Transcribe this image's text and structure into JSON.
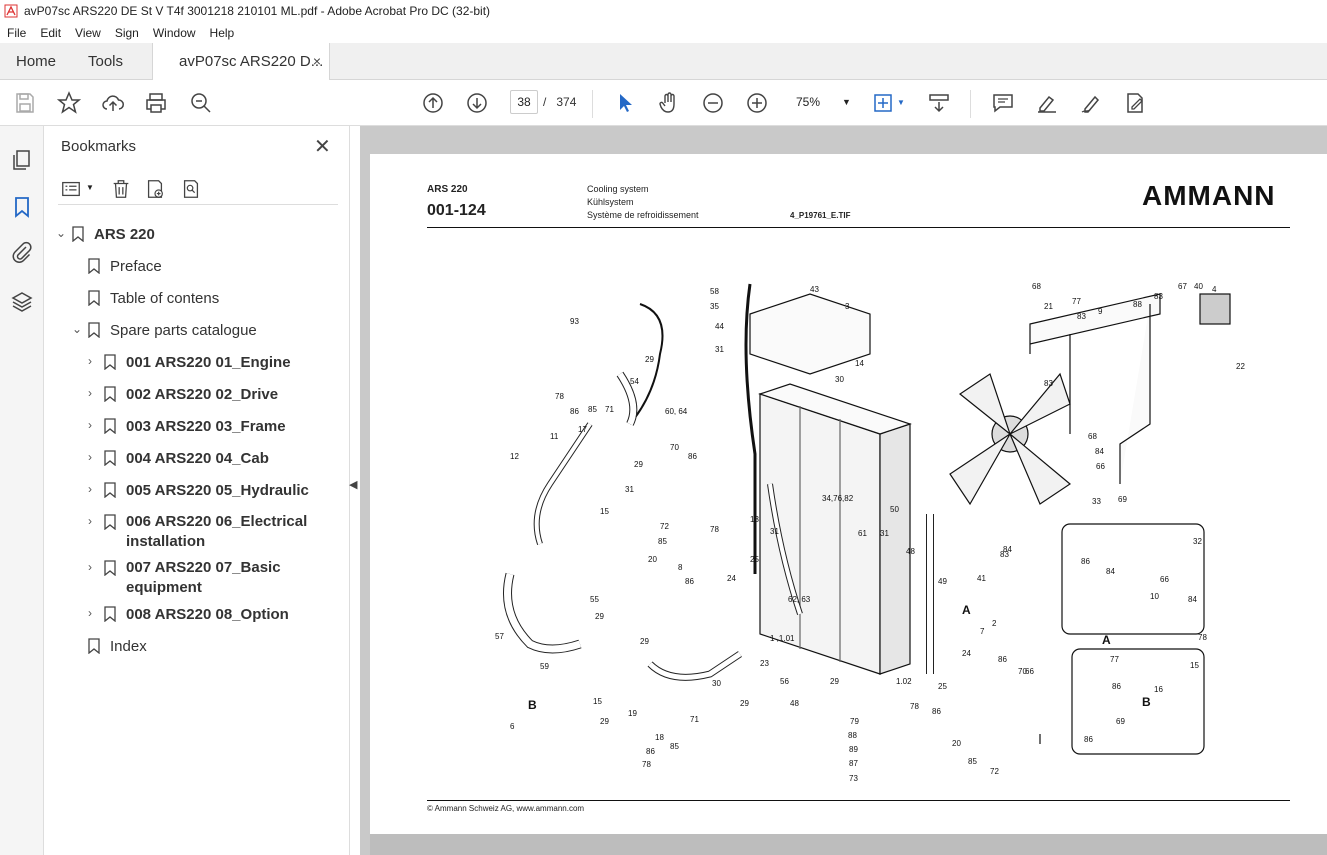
{
  "window": {
    "title": "avP07sc ARS220 DE St V T4f 3001218 210101 ML.pdf - Adobe Acrobat Pro DC (32-bit)"
  },
  "menu": [
    "File",
    "Edit",
    "View",
    "Sign",
    "Window",
    "Help"
  ],
  "tabs": {
    "home": "Home",
    "tools": "Tools",
    "doc": "avP07sc ARS220 D...",
    "close": "×"
  },
  "toolbar": {
    "page_current": "38",
    "page_sep": "/",
    "page_total": "374",
    "zoom": "75%"
  },
  "bookmarks": {
    "title": "Bookmarks",
    "close": "✕",
    "items": [
      {
        "label": "ARS 220"
      },
      {
        "label": "Preface"
      },
      {
        "label": "Table of contens"
      },
      {
        "label": "Spare parts catalogue"
      },
      {
        "label": "001 ARS220 01_Engine"
      },
      {
        "label": "002 ARS220 02_Drive"
      },
      {
        "label": "003 ARS220 03_Frame"
      },
      {
        "label": "004 ARS220 04_Cab"
      },
      {
        "label": "005 ARS220 05_Hydraulic"
      },
      {
        "label": "006 ARS220 06_Electrical installation"
      },
      {
        "label": "007 ARS220 07_Basic equipment"
      },
      {
        "label": "008 ARS220 08_Option"
      },
      {
        "label": "Index"
      }
    ]
  },
  "document": {
    "model": "ARS 220",
    "code": "001-124",
    "title_en": "Cooling system",
    "title_de": "Kühlsystem",
    "title_fr": "Système de refroidissement",
    "file": "4_P19761_E.TIF",
    "brand": "AMMANN",
    "footer": "© Ammann Schweiz AG, www.ammann.com",
    "callouts": [
      "93",
      "58",
      "35",
      "44",
      "31",
      "43",
      "3",
      "14",
      "30",
      "29",
      "54",
      "60, 64",
      "78",
      "86",
      "85",
      "71",
      "17",
      "11",
      "12",
      "70",
      "86",
      "31",
      "29",
      "15",
      "72",
      "85",
      "20",
      "8",
      "86",
      "78",
      "24",
      "55",
      "29",
      "57",
      "59",
      "29",
      "6",
      "B",
      "15",
      "29",
      "19",
      "18",
      "71",
      "85",
      "86",
      "78",
      "13",
      "31",
      "25",
      "34,76,82",
      "61",
      "31",
      "50",
      "62, 63",
      "1 ,1.01",
      "23",
      "30",
      "29",
      "56",
      "29",
      "48",
      "79",
      "88",
      "89",
      "87",
      "73",
      "1.02",
      "78",
      "86",
      "20",
      "85",
      "72",
      "7",
      "86",
      "70",
      "25",
      "A",
      "2",
      "24",
      "49",
      "48",
      "41",
      "66",
      "84",
      "83",
      "68",
      "21",
      "77",
      "83",
      "9",
      "88",
      "83",
      "67",
      "40",
      "4",
      "22",
      "83",
      "68",
      "84",
      "66",
      "33",
      "69",
      "86",
      "84",
      "66",
      "32",
      "10",
      "84",
      "77",
      "A",
      "16",
      "15",
      "86",
      "69",
      "78",
      "86",
      "B"
    ]
  }
}
